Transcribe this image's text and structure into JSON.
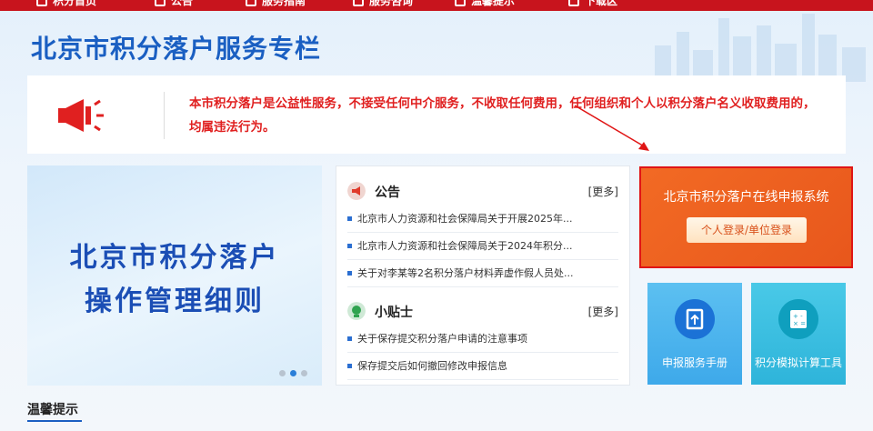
{
  "nav": {
    "items": [
      "积分首页",
      "公告",
      "服务指南",
      "服务咨询",
      "温馨提示",
      "下载区"
    ]
  },
  "page_title": "北京市积分落户服务专栏",
  "notice": {
    "text": "本市积分落户是公益性服务，不接受任何中介服务，不收取任何费用，任何组织和个人以积分落户名义收取费用的，均属违法行为。",
    "icon": "megaphone-icon",
    "color": "#e02020"
  },
  "banner": {
    "line1": "北京市积分落户",
    "line2": "操作管理细则",
    "slides": 3,
    "active_slide": 2
  },
  "announcements": {
    "title": "公告",
    "more": "[更多]",
    "items": [
      "北京市人力资源和社会保障局关于开展2025年...",
      "北京市人力资源和社会保障局关于2024年积分...",
      "关于对李某等2名积分落户材料弄虚作假人员处..."
    ]
  },
  "tips": {
    "title": "小贴士",
    "more": "[更多]",
    "items": [
      "关于保存提交积分落户申请的注意事项",
      "保存提交后如何撤回修改申报信息"
    ]
  },
  "online_system": {
    "title": "北京市积分落户在线申报系统",
    "login_label": "个人登录/单位登录",
    "color": "#f26a24"
  },
  "tiles": [
    {
      "label": "申报服务手册",
      "icon": "manual-icon"
    },
    {
      "label": "积分模拟计算工具",
      "icon": "calculator-icon"
    }
  ],
  "reminder_heading": "温馨提示"
}
